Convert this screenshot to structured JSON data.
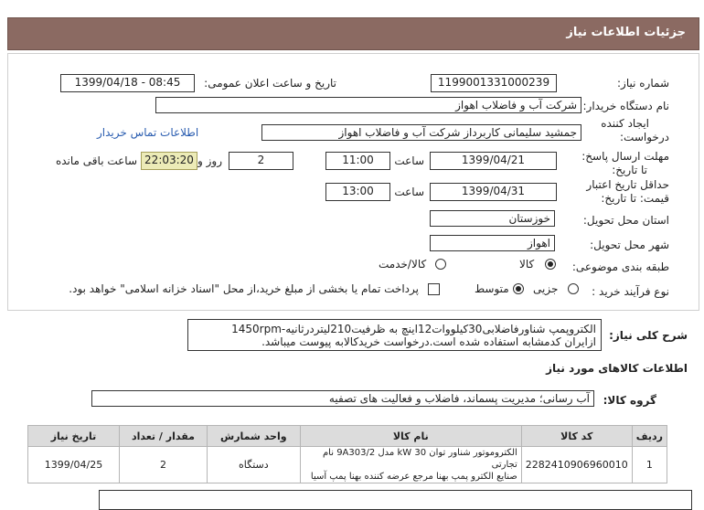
{
  "header": {
    "title": "جزئیات اطلاعات نیاز"
  },
  "form": {
    "need_number_label": "شماره نیاز:",
    "need_number": "1199001331000239",
    "announce_label": "تاریخ و ساعت اعلان عمومی:",
    "announce_value": "1399/04/18 - 08:45",
    "buyer_label": "نام دستگاه خریدار:",
    "buyer_value": "شرکت آب و فاضلاب اهواز",
    "creator_label_1": "ایجاد کننده",
    "creator_label_2": "درخواست:",
    "creator_value": "جمشید سلیمانی کاربرداز شرکت آب و فاضلاب اهواز",
    "contact_link": "اطلاعات تماس خریدار",
    "deadline_label_1": "مهلت ارسال پاسخ:",
    "deadline_label_2": "تا تاریخ:",
    "deadline_date": "1399/04/21",
    "time_label": "ساعت",
    "deadline_time": "11:00",
    "days_value": "2",
    "days_label": "روز و",
    "remaining_time": "22:03:20",
    "remaining_label": "ساعت باقی مانده",
    "validity_label_1": "حداقل تاریخ اعتبار",
    "validity_label_2": "قیمت: تا تاریخ:",
    "validity_date": "1399/04/31",
    "validity_time": "13:00",
    "province_label": "استان محل تحویل:",
    "province_value": "خوزستان",
    "city_label": "شهر محل تحویل:",
    "city_value": "اهواز",
    "category_label": "طبقه بندی موضوعی:",
    "category_options": [
      "کالا",
      "کالا/خدمت"
    ],
    "category_selected": "کالا",
    "process_label": "نوع فرآیند خرید :",
    "process_options": [
      "جزیی",
      "متوسط"
    ],
    "process_selected": "متوسط",
    "payment_note": "پرداخت تمام یا بخشی از مبلغ خرید،از محل \"اسناد خزانه اسلامی\" خواهد بود."
  },
  "description": {
    "label": "شرح کلی نیاز:",
    "line1": "الکتروپمپ شناورفاضلابی30کیلووات12اینچ به ظرفیت210لیتردرثانیه-1450rpm",
    "line2": "ازایران کدمشابه استفاده شده است.درخواست خریدکالابه پیوست میباشد."
  },
  "goods": {
    "section_title": "اطلاعات کالاهای مورد نیاز",
    "group_label": "گروه کالا:",
    "group_value": "آب رسانی؛ مدیریت پسماند، فاضلاب و فعالیت های تصفیه",
    "columns": [
      "ردیف",
      "کد کالا",
      "نام کالا",
      "واحد شمارش",
      "مقدار / تعداد",
      "تاریخ نیاز"
    ],
    "rows": [
      {
        "row": "1",
        "code": "2282410906960010",
        "name_line1": "الکتروموتور شناور توان 30 kW مدل 9A303/2 نام تجارتی",
        "name_line2": "صنایع الکترو پمپ بهنا مرجع عرضه کننده بهنا پمپ آسیا",
        "unit": "دستگاه",
        "qty": "2",
        "date": "1399/04/25"
      }
    ]
  }
}
